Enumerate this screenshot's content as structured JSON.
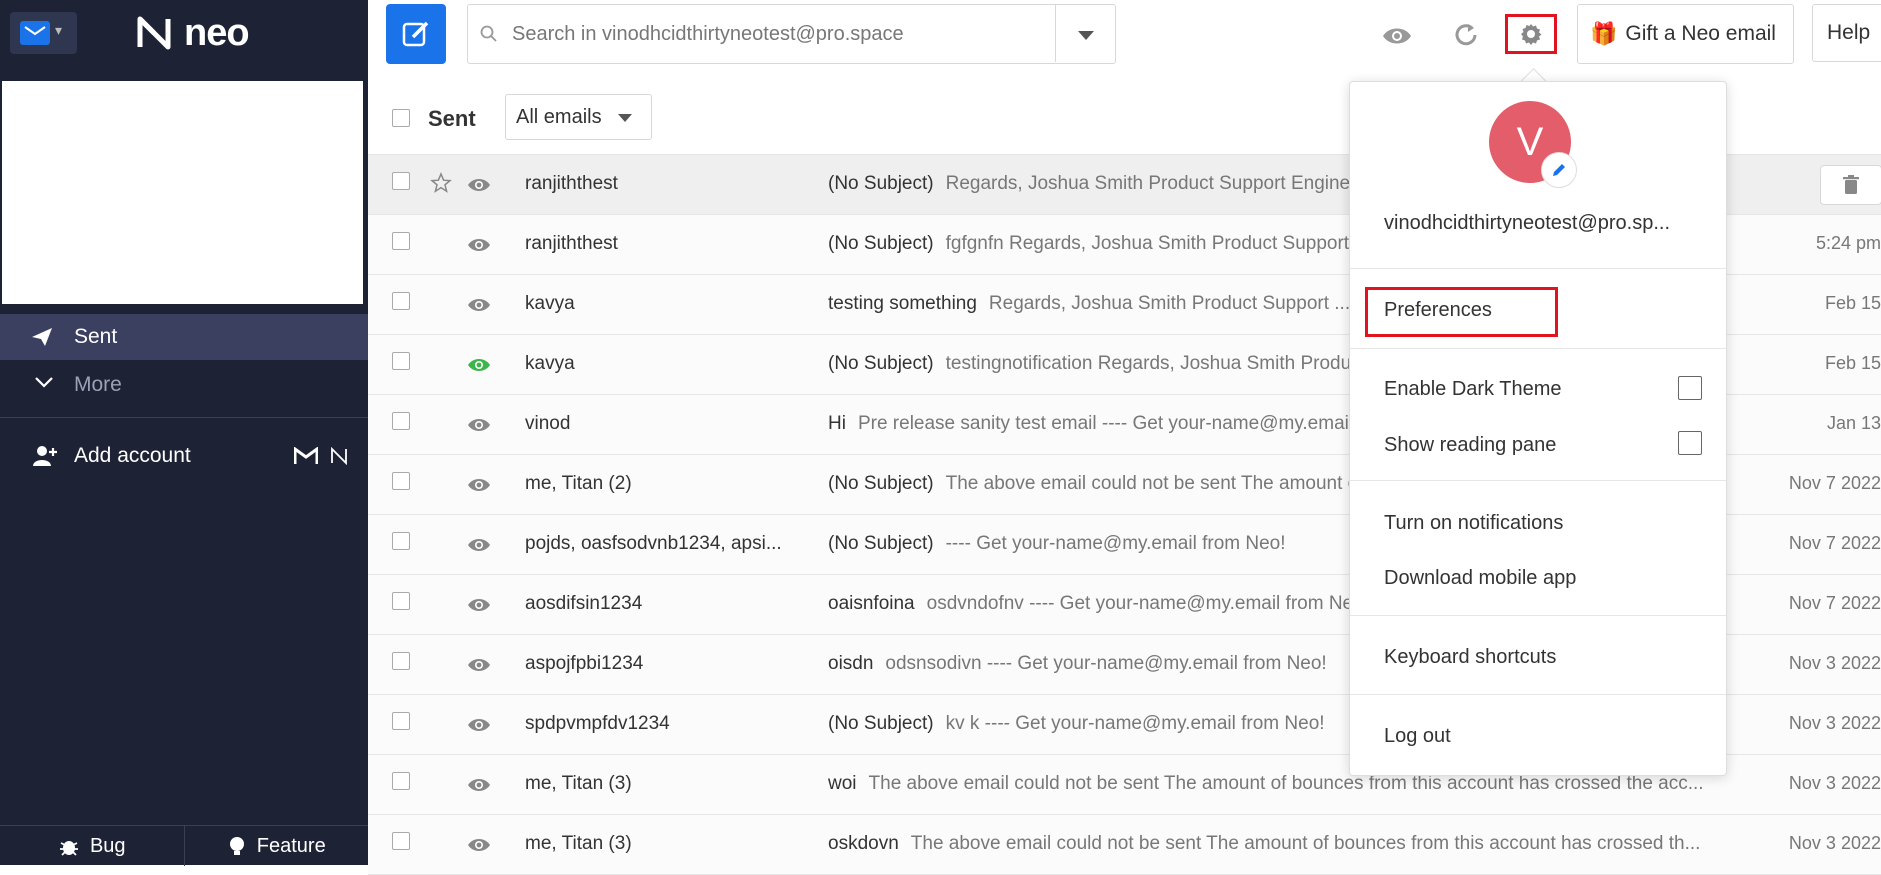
{
  "sidebar": {
    "logo_text": "neo",
    "nav": {
      "sent_label": "Sent",
      "more_label": "More"
    },
    "add_account_label": "Add account",
    "bottom": {
      "bug_label": "Bug",
      "feature_label": "Feature"
    }
  },
  "header": {
    "search_placeholder": "Search in vinodhcidthirtyneotest@pro.space",
    "gift_label": "Gift a Neo email",
    "help_label": "Help"
  },
  "toolbar": {
    "folder_label": "Sent",
    "filter_value": "All emails"
  },
  "emails": [
    {
      "sender": "ranjiththest",
      "subject": "(No Subject)",
      "preview": "Regards, Joshua Smith Product Support Engineer ...",
      "date": ""
    },
    {
      "sender": "ranjiththest",
      "subject": "(No Subject)",
      "preview": "fgfgnfn Regards, Joshua Smith Product Support ...",
      "date": "5:24 pm"
    },
    {
      "sender": "kavya",
      "subject": "testing something",
      "preview": "Regards, Joshua Smith Product Support ...",
      "date": "Feb 15"
    },
    {
      "sender": "kavya",
      "subject": "(No Subject)",
      "preview": "testingnotification Regards, Joshua Smith Product ...",
      "date": "Feb 15"
    },
    {
      "sender": "vinod",
      "subject": "Hi",
      "preview": "Pre release sanity test email ---- Get your-name@my.email ...",
      "date": "Jan 13"
    },
    {
      "sender": "me, Titan (2)",
      "subject": "(No Subject)",
      "preview": "The above email could not be sent The amount of bounces ...",
      "date": "Nov 7 2022"
    },
    {
      "sender": "pojds, oasfsodvnb1234, apsi...",
      "subject": "(No Subject)",
      "preview": "---- Get your-name@my.email from Neo!",
      "date": "Nov 7 2022"
    },
    {
      "sender": "aosdifsin1234",
      "subject": "oaisnfoina",
      "preview": "osdvndofnv ---- Get your-name@my.email from Neo!",
      "date": "Nov 7 2022"
    },
    {
      "sender": "aspojfpbi1234",
      "subject": "oisdn",
      "preview": "odsnsodivn ---- Get your-name@my.email from Neo!",
      "date": "Nov 3 2022"
    },
    {
      "sender": "spdpvmpfdv1234",
      "subject": "(No Subject)",
      "preview": "kv k ---- Get your-name@my.email from Neo!",
      "date": "Nov 3 2022"
    },
    {
      "sender": "me, Titan (3)",
      "subject": "woi",
      "preview": "The above email could not be sent The amount of bounces from this account has crossed the acc...",
      "date": "Nov 3 2022"
    },
    {
      "sender": "me, Titan (3)",
      "subject": "oskdovn",
      "preview": "The above email could not be sent The amount of bounces from this account has crossed th...",
      "date": "Nov 3 2022"
    }
  ],
  "menu": {
    "avatar_initial": "V",
    "email": "vinodhcidthirtyneotest@pro.sp...",
    "preferences": "Preferences",
    "dark_theme": "Enable Dark Theme",
    "reading_pane": "Show reading pane",
    "notifications": "Turn on notifications",
    "mobile_app": "Download mobile app",
    "shortcuts": "Keyboard shortcuts",
    "logout": "Log out"
  },
  "colors": {
    "sidebar_bg": "#1e2235",
    "active_nav": "#3b4060",
    "accent": "#1a73e8",
    "highlight": "#e0141e",
    "avatar": "#e35d6a",
    "read_eye_green": "#3cb54a"
  }
}
